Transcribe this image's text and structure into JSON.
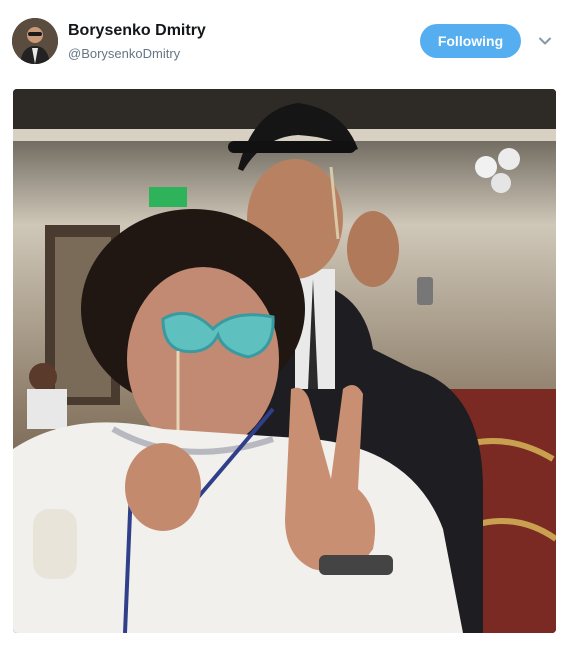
{
  "author": {
    "display_name": "Borysenko Dmitry",
    "username": "@BorysenkoDmitry"
  },
  "actions": {
    "follow_label": "Following"
  },
  "icons": {
    "menu": "chevron-down-icon"
  },
  "colors": {
    "follow_button": "#55aef0",
    "name": "#14171a",
    "handle": "#657786"
  }
}
